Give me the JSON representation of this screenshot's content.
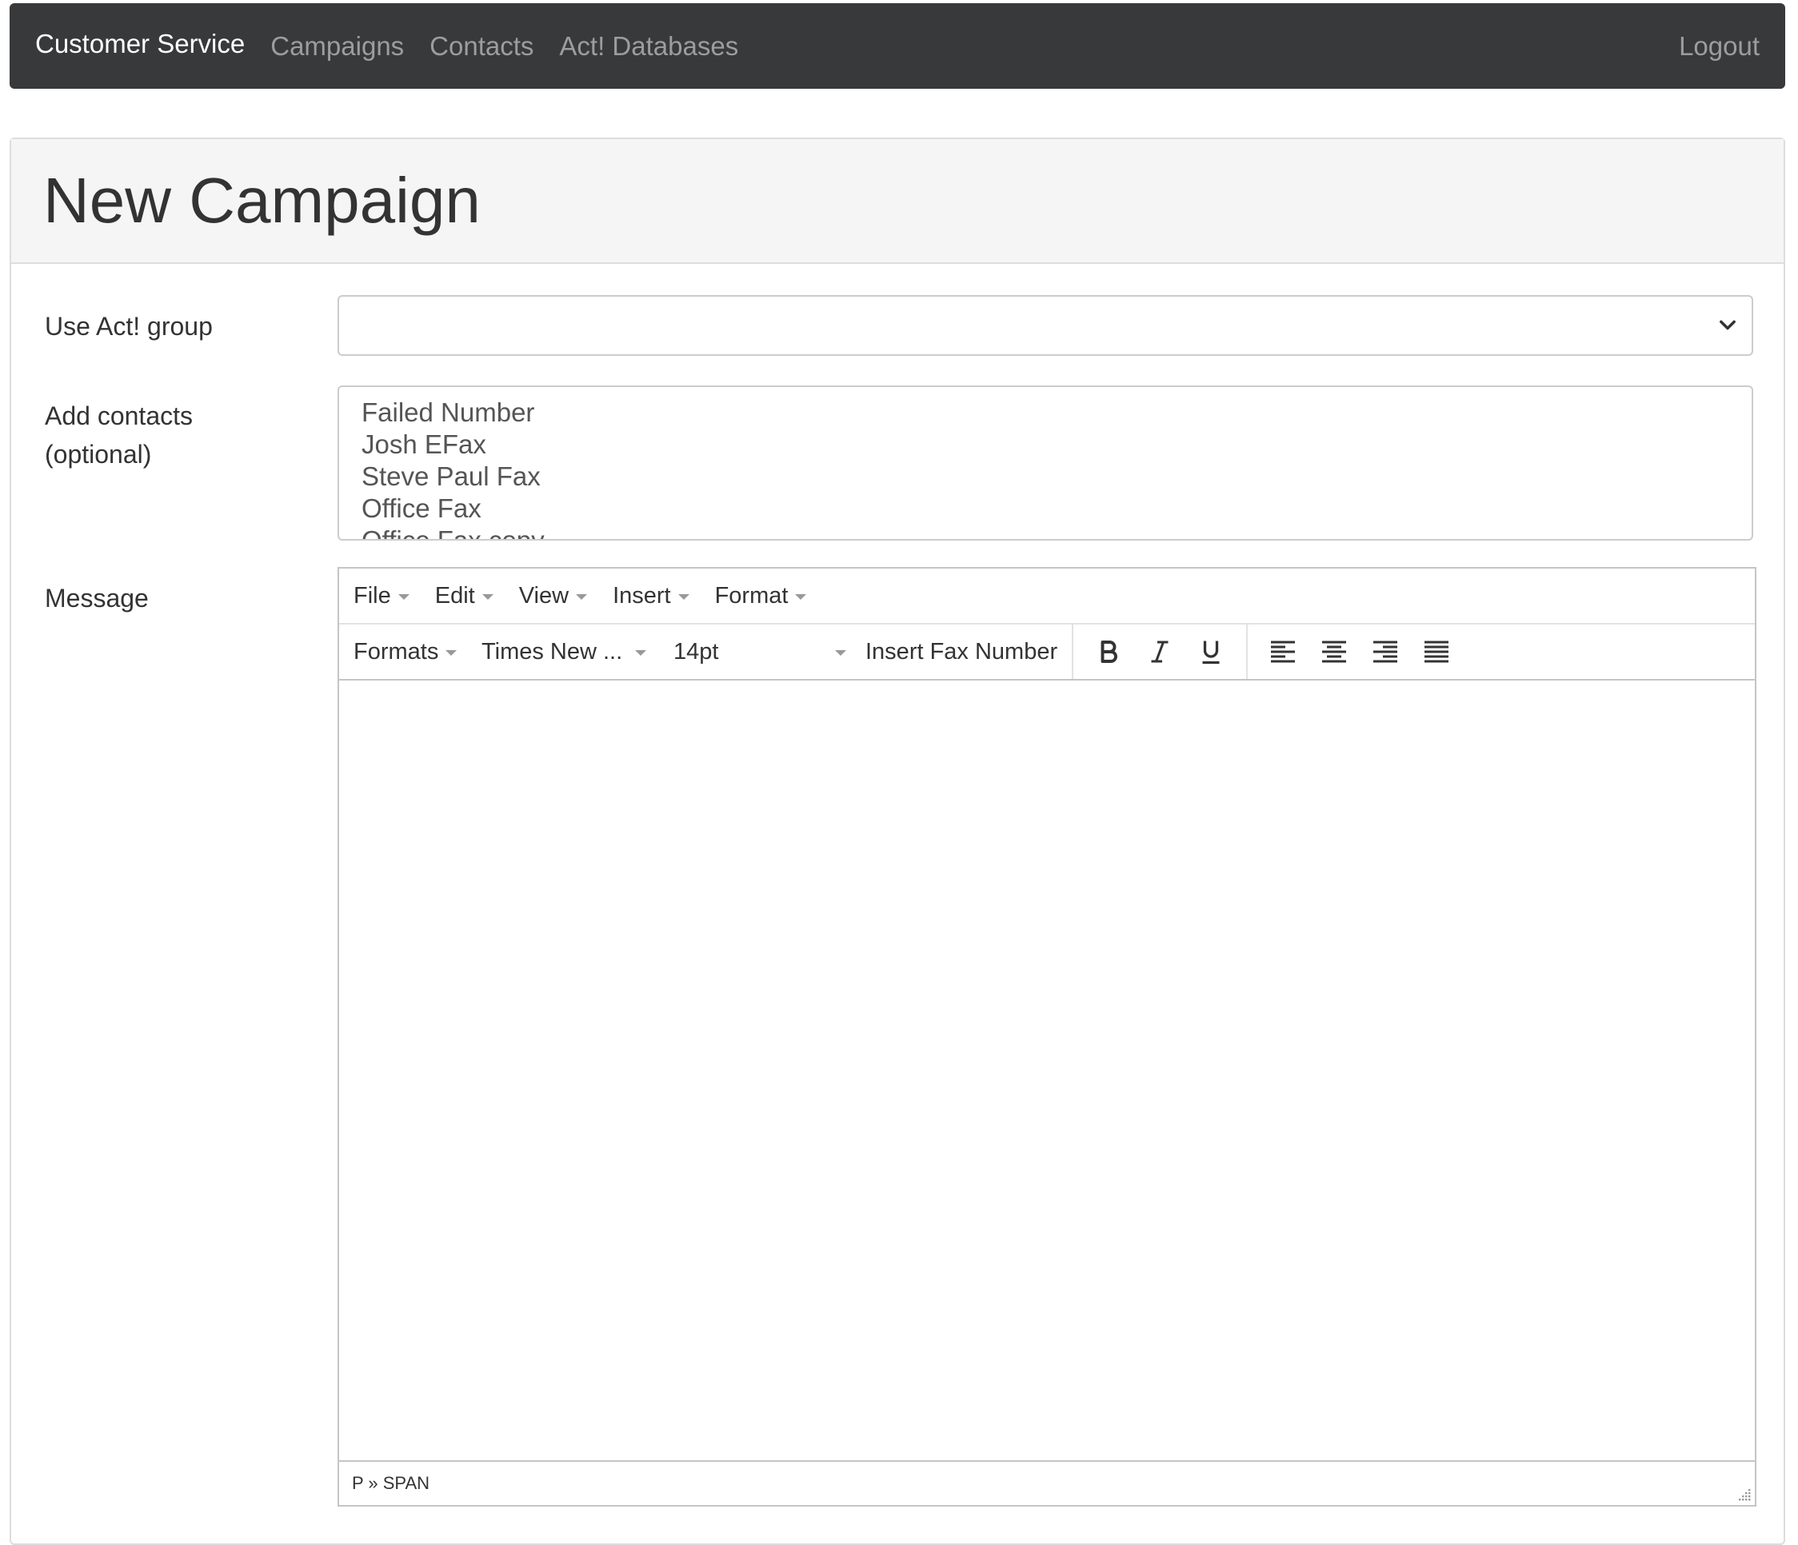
{
  "navbar": {
    "brand": "Customer Service",
    "links": [
      "Campaigns",
      "Contacts",
      "Act! Databases"
    ],
    "logout": "Logout"
  },
  "page": {
    "title": "New Campaign"
  },
  "form": {
    "group_label": "Use Act! group",
    "group_value": "",
    "contacts_label_line1": "Add contacts",
    "contacts_label_line2": "(optional)",
    "contacts_options": [
      "Failed Number",
      "Josh EFax",
      "Steve Paul Fax",
      "Office Fax",
      "Office Fax copy"
    ],
    "message_label": "Message"
  },
  "editor": {
    "menus": [
      "File",
      "Edit",
      "View",
      "Insert",
      "Format"
    ],
    "formats_label": "Formats",
    "font_value": "Times New ...",
    "size_value": "14pt",
    "insert_fax_label": "Insert Fax Number",
    "buttons": [
      "bold-icon",
      "italic-icon",
      "underline-icon",
      "align-left-icon",
      "align-center-icon",
      "align-right-icon",
      "align-justify-icon"
    ],
    "status_path": "P » SPAN"
  },
  "colors": {
    "navbar_bg": "#38393b",
    "brand_text": "#ffffff",
    "nav_link_text": "#9d9d9d",
    "panel_heading_bg": "#f5f5f5"
  }
}
